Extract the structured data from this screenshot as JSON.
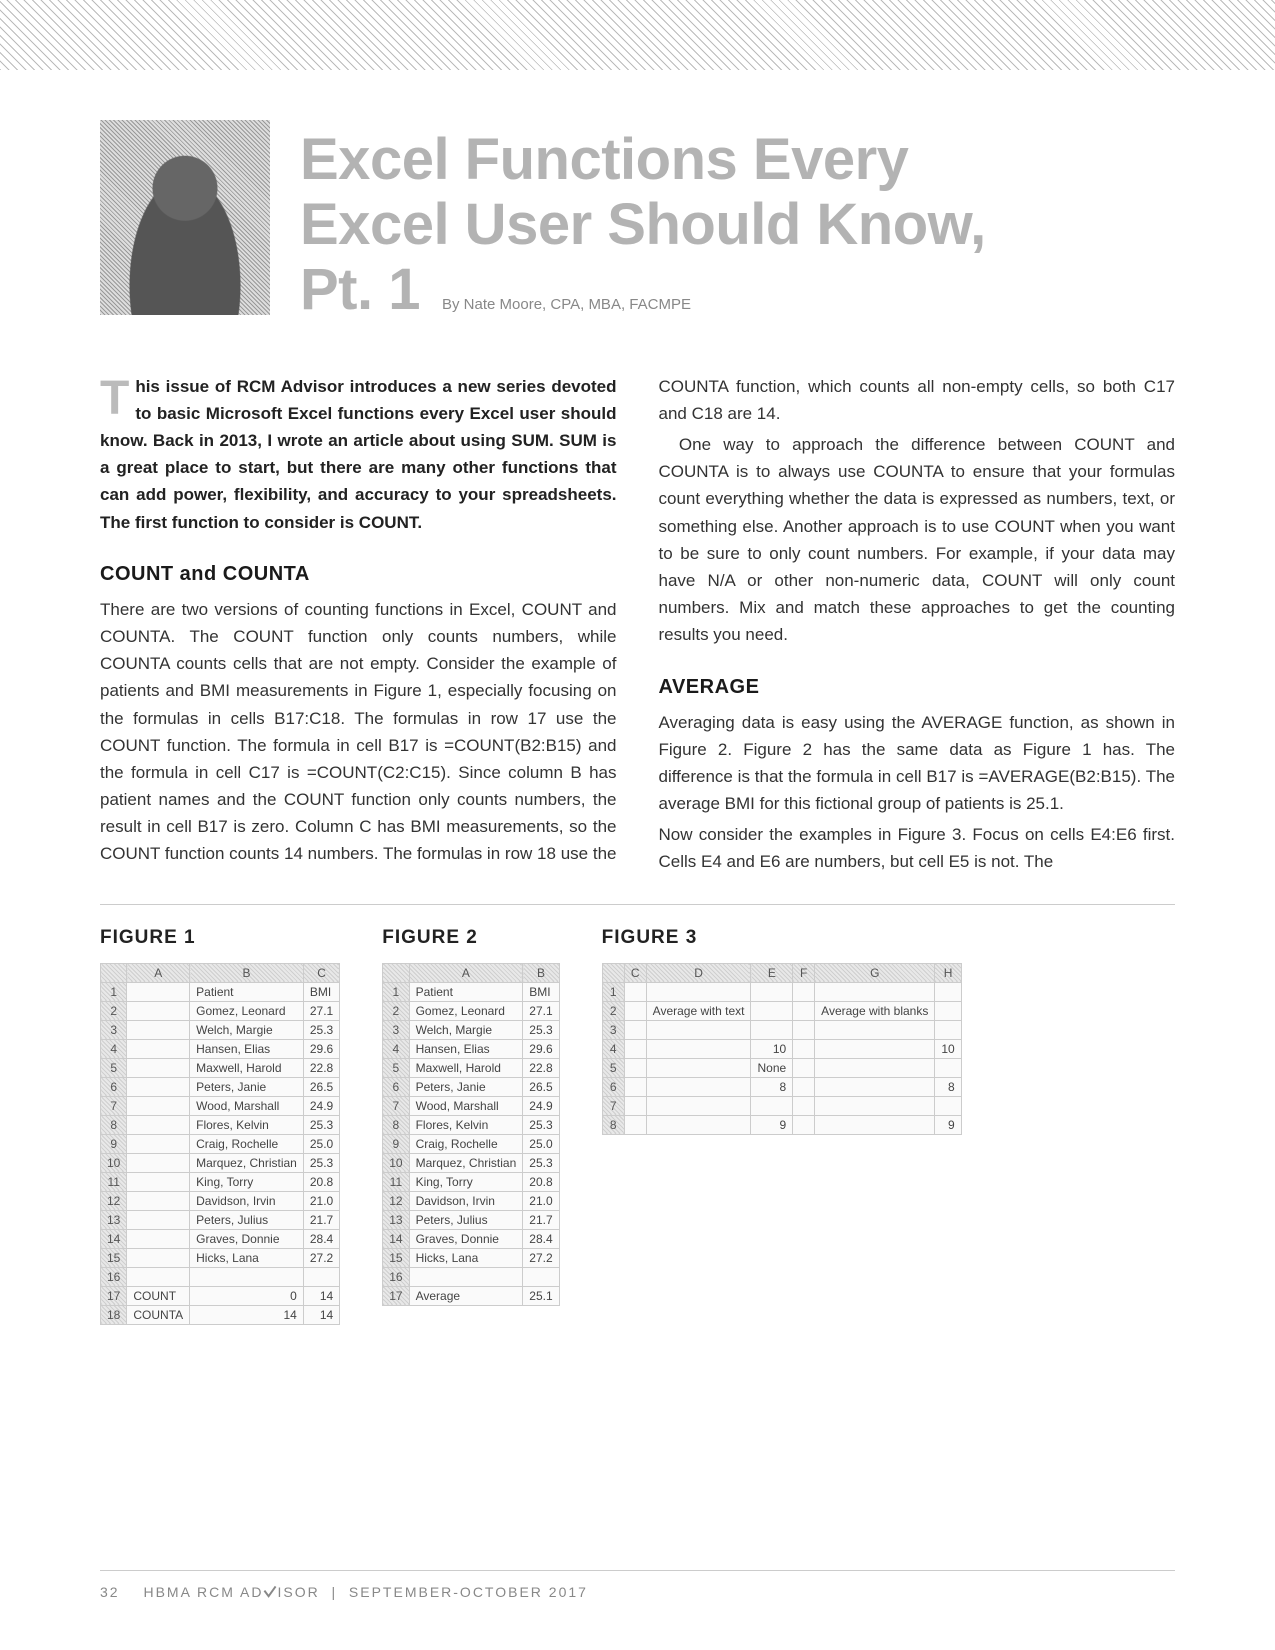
{
  "header": {
    "title_line1": "Excel Functions Every",
    "title_line2": "Excel User Should Know,",
    "title_line3": "Pt. 1",
    "byline": "By Nate Moore, CPA, MBA, FACMPE"
  },
  "intro": {
    "dropcap": "T",
    "text": "his issue of RCM Advisor introduces a new series devoted to basic Microsoft Excel functions every Excel user should know. Back in 2013, I wrote an article about using SUM. SUM is a great place to start, but there are many other functions that can add power, flexibility, and accuracy to your spreadsheets. The first function to consider is COUNT."
  },
  "sections": {
    "count_title": "COUNT and COUNTA",
    "count_p1": "There are two versions of counting functions in Excel, COUNT and COUNTA. The COUNT function only counts numbers, while COUNTA counts cells that are not empty. Consider the example of patients and BMI measurements in Figure 1, especially focusing on the formulas in cells B17:C18. The formulas in row 17 use the COUNT function. The formula in cell B17 is =COUNT(B2:B15) and the formula in cell C17 is =COUNT(C2:C15). Since column B has patient names and the COUNT function only counts numbers, the result in cell B17 is zero. Column C has BMI measurements, so the COUNT function counts 14 numbers. The formulas in row 18 use the COUNTA function, which counts all non-empty cells, so both C17 and C18 are 14.",
    "count_p2": "One way to approach the difference between COUNT and COUNTA is to always use COUNTA to ensure that your formulas count everything whether the data is expressed as numbers, text, or something else. Another approach is to use COUNT when you want to be sure to only count numbers. For example, if your data may have N/A or other non-numeric data, COUNT will only count numbers. Mix and match these approaches to get the counting results you need.",
    "avg_title": "AVERAGE",
    "avg_p1": "Averaging data is easy using the AVERAGE function, as shown in Figure 2. Figure 2 has the same data as Figure 1 has. The difference is that the formula in cell B17 is =AVERAGE(B2:B15). The average BMI for this fictional group of patients is 25.1.",
    "avg_p2": "Now consider the examples in Figure 3. Focus on cells E4:E6 first. Cells E4 and E6 are numbers, but cell E5 is not. The"
  },
  "figures": {
    "fig1_title": "FIGURE 1",
    "fig2_title": "FIGURE 2",
    "fig3_title": "FIGURE 3",
    "fig1": {
      "cols": [
        "",
        "A",
        "B",
        "C"
      ],
      "header_row": [
        "1",
        "",
        "Patient",
        "BMI"
      ],
      "rows": [
        [
          "2",
          "",
          "Gomez, Leonard",
          "27.1"
        ],
        [
          "3",
          "",
          "Welch, Margie",
          "25.3"
        ],
        [
          "4",
          "",
          "Hansen, Elias",
          "29.6"
        ],
        [
          "5",
          "",
          "Maxwell, Harold",
          "22.8"
        ],
        [
          "6",
          "",
          "Peters, Janie",
          "26.5"
        ],
        [
          "7",
          "",
          "Wood, Marshall",
          "24.9"
        ],
        [
          "8",
          "",
          "Flores, Kelvin",
          "25.3"
        ],
        [
          "9",
          "",
          "Craig, Rochelle",
          "25.0"
        ],
        [
          "10",
          "",
          "Marquez, Christian",
          "25.3"
        ],
        [
          "11",
          "",
          "King, Torry",
          "20.8"
        ],
        [
          "12",
          "",
          "Davidson, Irvin",
          "21.0"
        ],
        [
          "13",
          "",
          "Peters, Julius",
          "21.7"
        ],
        [
          "14",
          "",
          "Graves, Donnie",
          "28.4"
        ],
        [
          "15",
          "",
          "Hicks, Lana",
          "27.2"
        ],
        [
          "16",
          "",
          "",
          ""
        ],
        [
          "17",
          "COUNT",
          "0",
          "14"
        ],
        [
          "18",
          "COUNTA",
          "14",
          "14"
        ]
      ]
    },
    "fig2": {
      "cols": [
        "",
        "A",
        "B"
      ],
      "header_row": [
        "1",
        "Patient",
        "BMI"
      ],
      "rows": [
        [
          "2",
          "Gomez, Leonard",
          "27.1"
        ],
        [
          "3",
          "Welch, Margie",
          "25.3"
        ],
        [
          "4",
          "Hansen, Elias",
          "29.6"
        ],
        [
          "5",
          "Maxwell, Harold",
          "22.8"
        ],
        [
          "6",
          "Peters, Janie",
          "26.5"
        ],
        [
          "7",
          "Wood, Marshall",
          "24.9"
        ],
        [
          "8",
          "Flores, Kelvin",
          "25.3"
        ],
        [
          "9",
          "Craig, Rochelle",
          "25.0"
        ],
        [
          "10",
          "Marquez, Christian",
          "25.3"
        ],
        [
          "11",
          "King, Torry",
          "20.8"
        ],
        [
          "12",
          "Davidson, Irvin",
          "21.0"
        ],
        [
          "13",
          "Peters, Julius",
          "21.7"
        ],
        [
          "14",
          "Graves, Donnie",
          "28.4"
        ],
        [
          "15",
          "Hicks, Lana",
          "27.2"
        ],
        [
          "16",
          "",
          ""
        ],
        [
          "17",
          "Average",
          "25.1"
        ]
      ]
    },
    "fig3": {
      "cols": [
        "",
        "C",
        "D",
        "E",
        "F",
        "G",
        "H"
      ],
      "rows": [
        [
          "1",
          "",
          "",
          "",
          "",
          "",
          ""
        ],
        [
          "2",
          "",
          "Average with text",
          "",
          "",
          "Average with blanks",
          ""
        ],
        [
          "3",
          "",
          "",
          "",
          "",
          "",
          ""
        ],
        [
          "4",
          "",
          "",
          "10",
          "",
          "",
          "10"
        ],
        [
          "5",
          "",
          "",
          "None",
          "",
          "",
          ""
        ],
        [
          "6",
          "",
          "",
          "8",
          "",
          "",
          "8"
        ],
        [
          "7",
          "",
          "",
          "",
          "",
          "",
          ""
        ],
        [
          "8",
          "",
          "",
          "9",
          "",
          "",
          "9"
        ]
      ]
    }
  },
  "footer": {
    "page": "32",
    "pub": "HBMA RCM ADVISOR",
    "issue": "SEPTEMBER-OCTOBER 2017"
  }
}
